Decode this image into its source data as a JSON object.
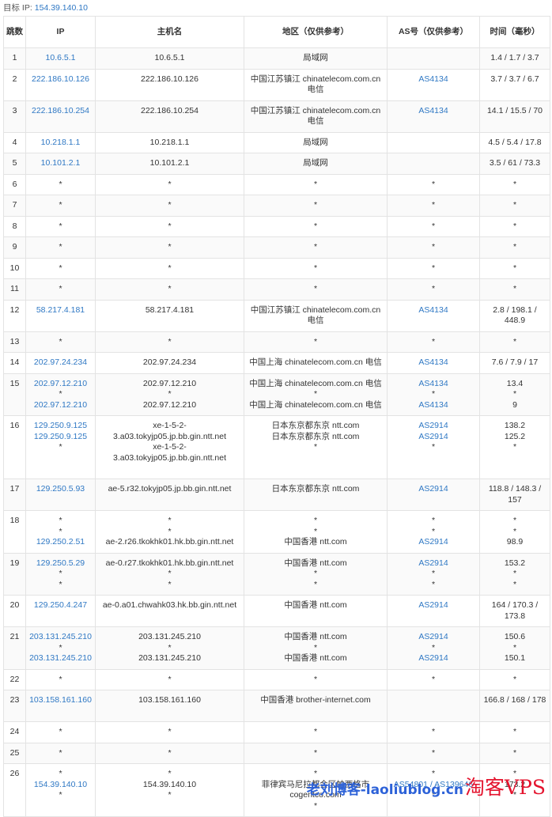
{
  "target": {
    "label": "目标 IP:",
    "ip": "154.39.140.10"
  },
  "columns": [
    "跳数",
    "IP",
    "主机名",
    "地区（仅供参考）",
    "AS号（仅供参考）",
    "时间（毫秒）"
  ],
  "rows": [
    {
      "hop": "1",
      "ip": [
        "10.6.5.1"
      ],
      "host": [
        "10.6.5.1"
      ],
      "region": [
        "局域网"
      ],
      "as": [
        ""
      ],
      "time": [
        "1.4 / 1.7 / 3.7"
      ]
    },
    {
      "hop": "2",
      "ip": [
        "222.186.10.126"
      ],
      "host": [
        "222.186.10.126"
      ],
      "region": [
        "中国江苏镇江 chinatelecom.com.cn 电信"
      ],
      "as": [
        "AS4134"
      ],
      "time": [
        "3.7 / 3.7 / 6.7"
      ]
    },
    {
      "hop": "3",
      "ip": [
        "222.186.10.254"
      ],
      "host": [
        "222.186.10.254"
      ],
      "region": [
        "中国江苏镇江 chinatelecom.com.cn 电信"
      ],
      "as": [
        "AS4134"
      ],
      "time": [
        "14.1 / 15.5 / 70"
      ]
    },
    {
      "hop": "4",
      "ip": [
        "10.218.1.1"
      ],
      "host": [
        "10.218.1.1"
      ],
      "region": [
        "局域网"
      ],
      "as": [
        ""
      ],
      "time": [
        "4.5 / 5.4 / 17.8"
      ]
    },
    {
      "hop": "5",
      "ip": [
        "10.101.2.1"
      ],
      "host": [
        "10.101.2.1"
      ],
      "region": [
        "局域网"
      ],
      "as": [
        ""
      ],
      "time": [
        "3.5 / 61 / 73.3"
      ]
    },
    {
      "hop": "6",
      "ip": [
        "*"
      ],
      "host": [
        "*"
      ],
      "region": [
        "*"
      ],
      "as": [
        "*"
      ],
      "time": [
        "*"
      ]
    },
    {
      "hop": "7",
      "ip": [
        "*"
      ],
      "host": [
        "*"
      ],
      "region": [
        "*"
      ],
      "as": [
        "*"
      ],
      "time": [
        "*"
      ]
    },
    {
      "hop": "8",
      "ip": [
        "*"
      ],
      "host": [
        "*"
      ],
      "region": [
        "*"
      ],
      "as": [
        "*"
      ],
      "time": [
        "*"
      ]
    },
    {
      "hop": "9",
      "ip": [
        "*"
      ],
      "host": [
        "*"
      ],
      "region": [
        "*"
      ],
      "as": [
        "*"
      ],
      "time": [
        "*"
      ]
    },
    {
      "hop": "10",
      "ip": [
        "*"
      ],
      "host": [
        "*"
      ],
      "region": [
        "*"
      ],
      "as": [
        "*"
      ],
      "time": [
        "*"
      ]
    },
    {
      "hop": "11",
      "ip": [
        "*"
      ],
      "host": [
        "*"
      ],
      "region": [
        "*"
      ],
      "as": [
        "*"
      ],
      "time": [
        "*"
      ]
    },
    {
      "hop": "12",
      "ip": [
        "58.217.4.181"
      ],
      "host": [
        "58.217.4.181"
      ],
      "region": [
        "中国江苏镇江 chinatelecom.com.cn 电信"
      ],
      "as": [
        "AS4134"
      ],
      "time": [
        "2.8 / 198.1 / 448.9"
      ]
    },
    {
      "hop": "13",
      "ip": [
        "*"
      ],
      "host": [
        "*"
      ],
      "region": [
        "*"
      ],
      "as": [
        "*"
      ],
      "time": [
        "*"
      ]
    },
    {
      "hop": "14",
      "ip": [
        "202.97.24.234"
      ],
      "host": [
        "202.97.24.234"
      ],
      "region": [
        "中国上海 chinatelecom.com.cn 电信"
      ],
      "as": [
        "AS4134"
      ],
      "time": [
        "7.6 / 7.9 / 17"
      ]
    },
    {
      "hop": "15",
      "ip": [
        "202.97.12.210",
        "*",
        "202.97.12.210"
      ],
      "host": [
        "202.97.12.210",
        "*",
        "202.97.12.210"
      ],
      "region": [
        "中国上海 chinatelecom.com.cn 电信",
        "*",
        "中国上海 chinatelecom.com.cn 电信"
      ],
      "as": [
        "AS4134",
        "*",
        "AS4134"
      ],
      "time": [
        "13.4",
        "*",
        "9"
      ]
    },
    {
      "hop": "16",
      "ip": [
        "129.250.9.125",
        "129.250.9.125",
        "*"
      ],
      "host": [
        "xe-1-5-2-3.a03.tokyjp05.jp.bb.gin.ntt.net",
        "xe-1-5-2-3.a03.tokyjp05.jp.bb.gin.ntt.net"
      ],
      "region": [
        "日本东京都东京 ntt.com",
        "日本东京都东京 ntt.com",
        "*"
      ],
      "as": [
        "AS2914",
        "AS2914",
        "*"
      ],
      "time": [
        "138.2",
        "125.2",
        "*"
      ]
    },
    {
      "hop": "17",
      "ip": [
        "129.250.5.93"
      ],
      "host": [
        "ae-5.r32.tokyjp05.jp.bb.gin.ntt.net"
      ],
      "region": [
        "日本东京都东京 ntt.com"
      ],
      "as": [
        "AS2914"
      ],
      "time": [
        "118.8 / 148.3 / 157"
      ]
    },
    {
      "hop": "18",
      "ip": [
        "*",
        "*",
        "129.250.2.51"
      ],
      "host": [
        "*",
        "*",
        "ae-2.r26.tkokhk01.hk.bb.gin.ntt.net"
      ],
      "region": [
        "*",
        "*",
        "中国香港 ntt.com"
      ],
      "as": [
        "*",
        "*",
        "AS2914"
      ],
      "time": [
        "*",
        "*",
        "98.9"
      ]
    },
    {
      "hop": "19",
      "ip": [
        "129.250.5.29",
        "*",
        "*"
      ],
      "host": [
        "ae-0.r27.tkokhk01.hk.bb.gin.ntt.net",
        "*",
        "*"
      ],
      "region": [
        "中国香港 ntt.com",
        "*",
        "*"
      ],
      "as": [
        "AS2914",
        "*",
        "*"
      ],
      "time": [
        "153.2",
        "*",
        "*"
      ]
    },
    {
      "hop": "20",
      "ip": [
        "129.250.4.247"
      ],
      "host": [
        "ae-0.a01.chwahk03.hk.bb.gin.ntt.net"
      ],
      "region": [
        "中国香港 ntt.com"
      ],
      "as": [
        "AS2914"
      ],
      "time": [
        "164 / 170.3 / 173.8"
      ]
    },
    {
      "hop": "21",
      "ip": [
        "203.131.245.210",
        "*",
        "203.131.245.210"
      ],
      "host": [
        "203.131.245.210",
        "*",
        "203.131.245.210"
      ],
      "region": [
        "中国香港 ntt.com",
        "*",
        "中国香港 ntt.com"
      ],
      "as": [
        "AS2914",
        "*",
        "AS2914"
      ],
      "time": [
        "150.6",
        "*",
        "150.1"
      ]
    },
    {
      "hop": "22",
      "ip": [
        "*"
      ],
      "host": [
        "*"
      ],
      "region": [
        "*"
      ],
      "as": [
        "*"
      ],
      "time": [
        "*"
      ]
    },
    {
      "hop": "23",
      "ip": [
        "103.158.161.160"
      ],
      "host": [
        "103.158.161.160"
      ],
      "region": [
        "中国香港 brother-internet.com"
      ],
      "as": [
        ""
      ],
      "time": [
        "166.8 / 168 / 178"
      ]
    },
    {
      "hop": "24",
      "ip": [
        "*"
      ],
      "host": [
        "*"
      ],
      "region": [
        "*"
      ],
      "as": [
        "*"
      ],
      "time": [
        "*"
      ]
    },
    {
      "hop": "25",
      "ip": [
        "*"
      ],
      "host": [
        "*"
      ],
      "region": [
        "*"
      ],
      "as": [
        "*"
      ],
      "time": [
        "*"
      ]
    },
    {
      "hop": "26",
      "ip": [
        "*",
        "154.39.140.10",
        "*"
      ],
      "host": [
        "*",
        "154.39.140.10",
        "*"
      ],
      "region": [
        "*",
        "菲律宾马尼拉都会区帕西格市 cogentco.com",
        "*"
      ],
      "as": [
        "*",
        "AS54801 / AS139646",
        "*"
      ],
      "time": [
        "*",
        "173.2",
        "*"
      ]
    }
  ],
  "watermark": {
    "left": "老刘博客-laoliublog.cn",
    "right": "淘客VPS"
  }
}
